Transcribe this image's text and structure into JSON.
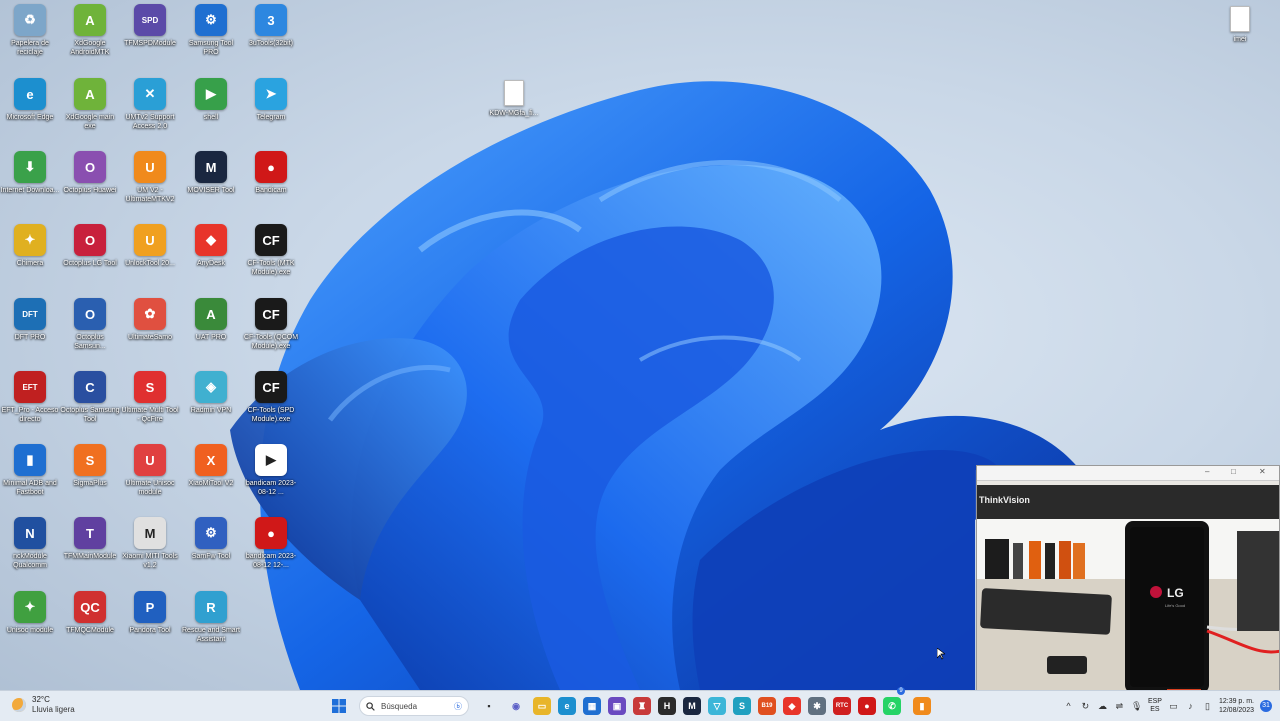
{
  "desktop_icons": [
    {
      "label": "Papelera de reciclaje",
      "color": "#7da6c9",
      "glyph": "♻"
    },
    {
      "label": "XdGoogle AndroidMTK",
      "color": "#6fb33a",
      "glyph": "A"
    },
    {
      "label": "TFMSPDModule",
      "color": "#5b4aa8",
      "glyph": "SPD"
    },
    {
      "label": "Samsung Tool PRO",
      "color": "#1f6fd1",
      "glyph": "⚙"
    },
    {
      "label": "3uTools(32bit)",
      "color": "#2d87e0",
      "glyph": "3"
    },
    {
      "label": "Microsoft Edge",
      "color": "#1c8fcf",
      "glyph": "e"
    },
    {
      "label": "XdGoogle main exe",
      "color": "#6fb33a",
      "glyph": "A"
    },
    {
      "label": "UMTv2 Support Access 2.0",
      "color": "#2a9fd6",
      "glyph": "✕"
    },
    {
      "label": "shell",
      "color": "#37a04a",
      "glyph": "▶"
    },
    {
      "label": "Telegram",
      "color": "#2aa3e0",
      "glyph": "➤"
    },
    {
      "label": "Internet Downloa...",
      "color": "#3aa14a",
      "glyph": "⬇"
    },
    {
      "label": "Octoplus Huawei",
      "color": "#8a4fb0",
      "glyph": "O"
    },
    {
      "label": "UM V2 - UltimateMTKV2",
      "color": "#f08a1c",
      "glyph": "U"
    },
    {
      "label": "MOVISER Tool",
      "color": "#1a2740",
      "glyph": "M"
    },
    {
      "label": "Bandicam",
      "color": "#d01818",
      "glyph": "●"
    },
    {
      "label": "Chimera",
      "color": "#e0b020",
      "glyph": "✦"
    },
    {
      "label": "Octoplus LG Tool",
      "color": "#c8203c",
      "glyph": "O"
    },
    {
      "label": "UnlockTool 20...",
      "color": "#f0a020",
      "glyph": "U"
    },
    {
      "label": "AnyDesk",
      "color": "#e8352a",
      "glyph": "◆"
    },
    {
      "label": "CF-Tools (MTK Module).exe",
      "color": "#1a1a1a",
      "glyph": "CF"
    },
    {
      "label": "DFT PRO",
      "color": "#1d6fb5",
      "glyph": "DFT"
    },
    {
      "label": "Octoplus Samsun...",
      "color": "#2a5fb0",
      "glyph": "O"
    },
    {
      "label": "UltimateSamo",
      "color": "#e05040",
      "glyph": "✿"
    },
    {
      "label": "UAT PRO",
      "color": "#3a8a3a",
      "glyph": "A"
    },
    {
      "label": "CF-Tools (QCOM Module).exe",
      "color": "#1a1a1a",
      "glyph": "CF"
    },
    {
      "label": "EFT_Pro - Acceso directo",
      "color": "#c02020",
      "glyph": "EFT"
    },
    {
      "label": "Octoplus Samsung Tool",
      "color": "#2a4fa0",
      "glyph": "C"
    },
    {
      "label": "Ultimate Multi Tool - QcFire",
      "color": "#e03030",
      "glyph": "S"
    },
    {
      "label": "Radmin VPN",
      "color": "#40b0d0",
      "glyph": "◈"
    },
    {
      "label": "CF-Tools (SPD Module).exe",
      "color": "#1a1a1a",
      "glyph": "CF"
    },
    {
      "label": "Minimal ADB and Fastboot",
      "color": "#1f6fd1",
      "glyph": "▮"
    },
    {
      "label": "SigmaPlus",
      "color": "#f07020",
      "glyph": "S"
    },
    {
      "label": "Ultimate Unisoc module",
      "color": "#e04040",
      "glyph": "U"
    },
    {
      "label": "XiaoMiTool V2",
      "color": "#f06020",
      "glyph": "X"
    },
    {
      "label": "bandicam 2023-08-12 ...",
      "color": "#ffffff",
      "glyph": "▶"
    },
    {
      "label": "nckModule Qualcomm",
      "color": "#2050a0",
      "glyph": "N"
    },
    {
      "label": "TFMMainModule",
      "color": "#6040a0",
      "glyph": "T"
    },
    {
      "label": "Xiaomi MITI Tools v1.2",
      "color": "#e0e0e0",
      "glyph": "M"
    },
    {
      "label": "SamFw Tool",
      "color": "#3060c0",
      "glyph": "⚙"
    },
    {
      "label": "bandicam 2023-08-12 12-...",
      "color": "#d01818",
      "glyph": "●"
    },
    {
      "label": "Unisoc module",
      "color": "#40a040",
      "glyph": "✦"
    },
    {
      "label": "TFMQCModule",
      "color": "#d03030",
      "glyph": "QC"
    },
    {
      "label": "Pandora Tool",
      "color": "#2060c0",
      "glyph": "P"
    },
    {
      "label": "Rescue and Smart Assistant",
      "color": "#30a0d0",
      "glyph": "R"
    }
  ],
  "extra_icons": {
    "center_file": {
      "label": "KDW-MGfa_fi..."
    },
    "right_file": {
      "label": "imei"
    }
  },
  "taskbar": {
    "weather": {
      "temp": "32°C",
      "desc": "Lluvia ligera"
    },
    "search_placeholder": "Búsqueda",
    "pinned": [
      {
        "name": "file-explorer",
        "color": "#e8b52a",
        "glyph": "▭"
      },
      {
        "name": "edge",
        "color": "#1c8fcf",
        "glyph": "e"
      },
      {
        "name": "store",
        "color": "#1f6fd1",
        "glyph": "▦"
      },
      {
        "name": "app-purple",
        "color": "#6a4ac0",
        "glyph": "▣"
      },
      {
        "name": "app-red",
        "color": "#c83a3a",
        "glyph": "♜"
      },
      {
        "name": "app-h",
        "color": "#2b2b2b",
        "glyph": "H"
      },
      {
        "name": "app-m",
        "color": "#1a2740",
        "glyph": "M"
      },
      {
        "name": "vpn",
        "color": "#3cb6d8",
        "glyph": "▽"
      },
      {
        "name": "app-s",
        "color": "#20a0c0",
        "glyph": "S"
      },
      {
        "name": "app-b19",
        "color": "#e05020",
        "glyph": "B19"
      },
      {
        "name": "anydesk",
        "color": "#e8352a",
        "glyph": "◆"
      },
      {
        "name": "app-misc",
        "color": "#607080",
        "glyph": "✱"
      },
      {
        "name": "rtc-tool",
        "color": "#d02020",
        "glyph": "RTC"
      },
      {
        "name": "bandicam",
        "color": "#d01818",
        "glyph": "●"
      },
      {
        "name": "whatsapp",
        "color": "#25d366",
        "glyph": "✆"
      },
      {
        "name": "app-orange",
        "color": "#f08a1c",
        "glyph": "▮"
      }
    ],
    "whatsapp_badge": "9",
    "lang_top": "ESP",
    "lang_bottom": "ES",
    "time": "12:39 p. m.",
    "date": "12/08/2023",
    "notifications": "31"
  },
  "camera": {
    "monitor_brand": "ThinkVision",
    "phone_logo": "LG",
    "phone_tagline": "Life's Good"
  }
}
